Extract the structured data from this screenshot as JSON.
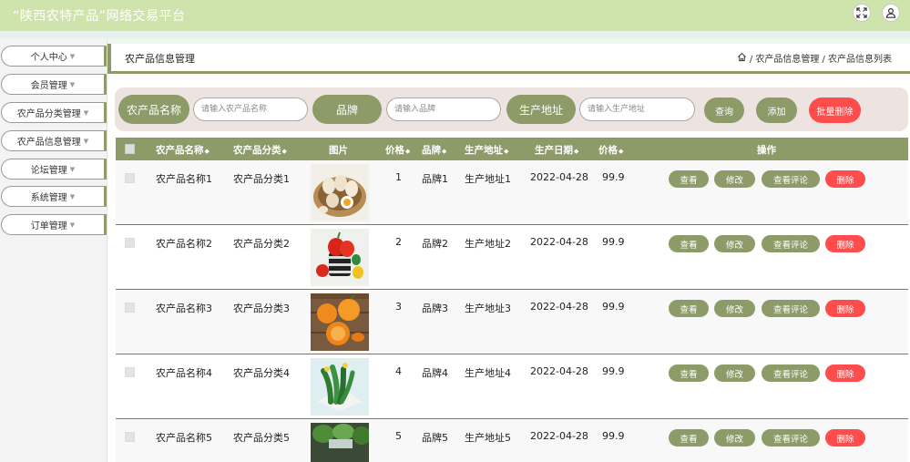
{
  "app": {
    "title": "“陕西农特产品”网络交易平台"
  },
  "topbar": {
    "fullscreen_icon": "fullscreen-icon",
    "user_icon": "user-icon"
  },
  "sidebar": {
    "items": [
      {
        "label": "个人中心"
      },
      {
        "label": "会员管理"
      },
      {
        "label": "农产品分类管理"
      },
      {
        "label": "农产品信息管理"
      },
      {
        "label": "论坛管理"
      },
      {
        "label": "系统管理"
      },
      {
        "label": "订单管理"
      }
    ]
  },
  "header": {
    "title": "农产品信息管理",
    "breadcrumb": {
      "home_icon": "home-icon",
      "level1": "/ 农产品信息管理",
      "level2": "/ 农产品信息列表"
    }
  },
  "search": {
    "name_label": "农产品名称",
    "name_placeholder": "请输入农产品名称",
    "brand_label": "品牌",
    "brand_placeholder": "请输入品牌",
    "origin_label": "生产地址",
    "origin_placeholder": "请输入生产地址",
    "query_button": "查询",
    "add_button": "添加",
    "batch_delete_button": "批量删除"
  },
  "colors": {
    "accent": "#8c9b68",
    "danger": "#ff4c4c",
    "topbar": "#cfe3ad",
    "search_bg": "#ede3e0"
  },
  "table": {
    "headers": {
      "name": "农产品名称",
      "category": "农产品分类",
      "image": "图片",
      "price": "价格",
      "brand": "品牌",
      "origin": "生产地址",
      "date": "生产日期",
      "price2": "价格",
      "actions": "操作"
    },
    "sort_glyph": "◆",
    "actions": {
      "view": "查看",
      "edit": "修改",
      "comments": "查看评论",
      "delete": "删除"
    },
    "rows": [
      {
        "name": "农产品名称1",
        "category": "农产品分类1",
        "image": "eggs-photo",
        "price": "1",
        "brand": "品牌1",
        "origin": "生产地址1",
        "date": "2022-04-28",
        "price2": "99.9"
      },
      {
        "name": "农产品名称2",
        "category": "农产品分类2",
        "image": "peppers-photo",
        "price": "2",
        "brand": "品牌2",
        "origin": "生产地址2",
        "date": "2022-04-28",
        "price2": "99.9"
      },
      {
        "name": "农产品名称3",
        "category": "农产品分类3",
        "image": "oranges-photo",
        "price": "3",
        "brand": "品牌3",
        "origin": "生产地址3",
        "date": "2022-04-28",
        "price2": "99.9"
      },
      {
        "name": "农产品名称4",
        "category": "农产品分类4",
        "image": "cucumbers-photo",
        "price": "4",
        "brand": "品牌4",
        "origin": "生产地址4",
        "date": "2022-04-28",
        "price2": "99.9"
      },
      {
        "name": "农产品名称5",
        "category": "农产品分类5",
        "image": "vegetables-photo",
        "price": "5",
        "brand": "品牌5",
        "origin": "生产地址5",
        "date": "2022-04-28",
        "price2": "99.9"
      }
    ]
  }
}
